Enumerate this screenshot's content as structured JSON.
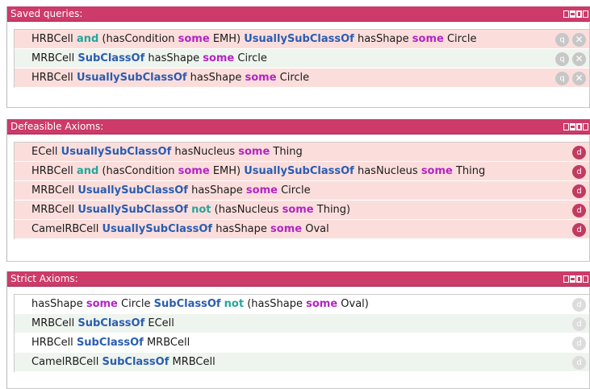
{
  "panels": [
    {
      "id": "saved-queries",
      "title": "Saved queries:",
      "rows": [
        {
          "style": "pink",
          "tokens": [
            {
              "t": "HRBCell "
            },
            {
              "t": "and",
              "k": "and"
            },
            {
              "t": " (hasCondition "
            },
            {
              "t": "some",
              "k": "some"
            },
            {
              "t": " EMH) "
            },
            {
              "t": "UsuallySubClassOf",
              "k": "rel"
            },
            {
              "t": " hasShape "
            },
            {
              "t": "some",
              "k": "some"
            },
            {
              "t": " Circle"
            }
          ],
          "actions": [
            "query",
            "delete"
          ]
        },
        {
          "style": "green",
          "tokens": [
            {
              "t": "MRBCell "
            },
            {
              "t": "SubClassOf",
              "k": "rel"
            },
            {
              "t": " hasShape "
            },
            {
              "t": "some",
              "k": "some"
            },
            {
              "t": " Circle"
            }
          ],
          "actions": [
            "query",
            "delete"
          ]
        },
        {
          "style": "pink",
          "tokens": [
            {
              "t": "HRBCell "
            },
            {
              "t": "UsuallySubClassOf",
              "k": "rel"
            },
            {
              "t": " hasShape "
            },
            {
              "t": "some",
              "k": "some"
            },
            {
              "t": " Circle"
            }
          ],
          "actions": [
            "query",
            "delete"
          ]
        }
      ]
    },
    {
      "id": "defeasible-axioms",
      "title": "Defeasible Axioms:",
      "rows": [
        {
          "style": "pink",
          "tokens": [
            {
              "t": "ECell "
            },
            {
              "t": "UsuallySubClassOf",
              "k": "rel"
            },
            {
              "t": " hasNucleus "
            },
            {
              "t": "some",
              "k": "some"
            },
            {
              "t": " Thing"
            }
          ],
          "actions": [
            "d-red"
          ]
        },
        {
          "style": "pink",
          "tokens": [
            {
              "t": "HRBCell "
            },
            {
              "t": "and",
              "k": "and"
            },
            {
              "t": " (hasCondition "
            },
            {
              "t": "some",
              "k": "some"
            },
            {
              "t": " EMH) "
            },
            {
              "t": "UsuallySubClassOf",
              "k": "rel"
            },
            {
              "t": " hasNucleus "
            },
            {
              "t": "some",
              "k": "some"
            },
            {
              "t": " Thing"
            }
          ],
          "actions": [
            "d-red"
          ]
        },
        {
          "style": "pink",
          "tokens": [
            {
              "t": "MRBCell "
            },
            {
              "t": "UsuallySubClassOf",
              "k": "rel"
            },
            {
              "t": " hasShape "
            },
            {
              "t": "some",
              "k": "some"
            },
            {
              "t": " Circle"
            }
          ],
          "actions": [
            "d-red"
          ]
        },
        {
          "style": "pink",
          "tokens": [
            {
              "t": "MRBCell "
            },
            {
              "t": "UsuallySubClassOf",
              "k": "rel"
            },
            {
              "t": " "
            },
            {
              "t": "not",
              "k": "not"
            },
            {
              "t": " (hasNucleus "
            },
            {
              "t": "some",
              "k": "some"
            },
            {
              "t": " Thing)"
            }
          ],
          "actions": [
            "d-red"
          ]
        },
        {
          "style": "pink",
          "tokens": [
            {
              "t": "CamelRBCell "
            },
            {
              "t": "UsuallySubClassOf",
              "k": "rel"
            },
            {
              "t": " hasShape "
            },
            {
              "t": "some",
              "k": "some"
            },
            {
              "t": " Oval"
            }
          ],
          "actions": [
            "d-red"
          ]
        }
      ]
    },
    {
      "id": "strict-axioms",
      "title": "Strict Axioms:",
      "rows": [
        {
          "style": "white",
          "tokens": [
            {
              "t": "hasShape "
            },
            {
              "t": "some",
              "k": "some"
            },
            {
              "t": " Circle "
            },
            {
              "t": "SubClassOf",
              "k": "rel"
            },
            {
              "t": " "
            },
            {
              "t": "not",
              "k": "not"
            },
            {
              "t": " (hasShape "
            },
            {
              "t": "some",
              "k": "some"
            },
            {
              "t": " Oval)"
            }
          ],
          "actions": [
            "d-grey"
          ]
        },
        {
          "style": "green",
          "tokens": [
            {
              "t": "MRBCell "
            },
            {
              "t": "SubClassOf",
              "k": "rel"
            },
            {
              "t": " ECell"
            }
          ],
          "actions": [
            "d-grey"
          ]
        },
        {
          "style": "white",
          "tokens": [
            {
              "t": "HRBCell "
            },
            {
              "t": "SubClassOf",
              "k": "rel"
            },
            {
              "t": " MRBCell"
            }
          ],
          "actions": [
            "d-grey"
          ]
        },
        {
          "style": "green",
          "tokens": [
            {
              "t": "CamelRBCell "
            },
            {
              "t": "SubClassOf",
              "k": "rel"
            },
            {
              "t": " MRBCell"
            }
          ],
          "actions": [
            "d-grey"
          ]
        }
      ]
    }
  ],
  "action_glyphs": {
    "query": "q",
    "delete": "✕",
    "d-red": "d",
    "d-grey": "d"
  },
  "colors": {
    "header": "#cc3b6a",
    "keyword_and_not": "#26a69a",
    "keyword_some": "#b225c2",
    "keyword_relation": "#2a5db0",
    "row_pink": "#fbdedc",
    "row_green": "#eef4ee"
  }
}
